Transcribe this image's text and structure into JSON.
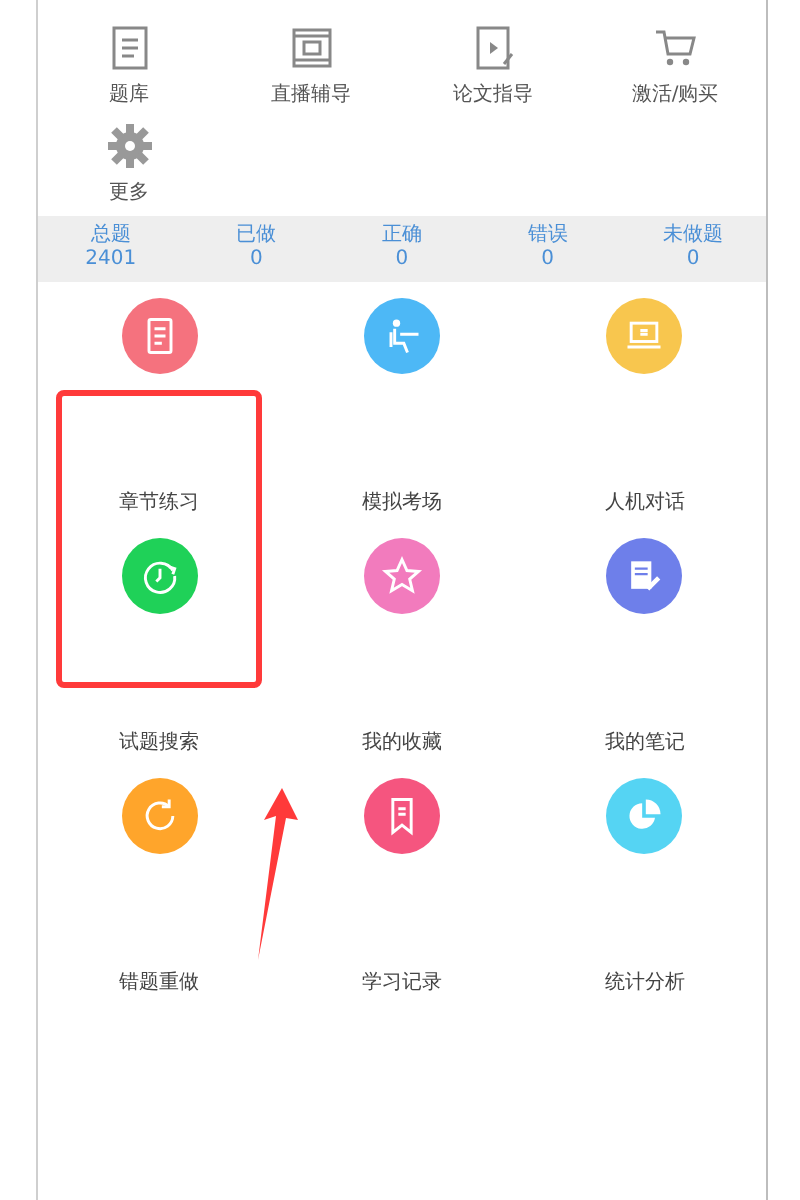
{
  "shortcuts": [
    {
      "label": "题库"
    },
    {
      "label": "直播辅导"
    },
    {
      "label": "论文指导"
    },
    {
      "label": "激活/购买"
    },
    {
      "label": "更多"
    }
  ],
  "stats": [
    {
      "label": "总题",
      "value": "2401"
    },
    {
      "label": "已做",
      "value": "0"
    },
    {
      "label": "正确",
      "value": "0"
    },
    {
      "label": "错误",
      "value": "0"
    },
    {
      "label": "未做题",
      "value": "0"
    }
  ],
  "modules": [
    {
      "label": "章节练习",
      "color": "#f5727e"
    },
    {
      "label": "模拟考场",
      "color": "#4db8f6"
    },
    {
      "label": "人机对话",
      "color": "#f8c64e"
    },
    {
      "label": "试题搜索",
      "color": "#1fd158"
    },
    {
      "label": "我的收藏",
      "color": "#f27bbd"
    },
    {
      "label": "我的笔记",
      "color": "#6e7fea"
    },
    {
      "label": "错题重做",
      "color": "#ffa52b"
    },
    {
      "label": "学习记录",
      "color": "#f5557f"
    },
    {
      "label": "统计分析",
      "color": "#55d4f3"
    }
  ],
  "annotations": [
    {
      "kind": "box",
      "color": "#ff3a3a"
    },
    {
      "kind": "arrow",
      "color": "#ff3a3a"
    }
  ]
}
